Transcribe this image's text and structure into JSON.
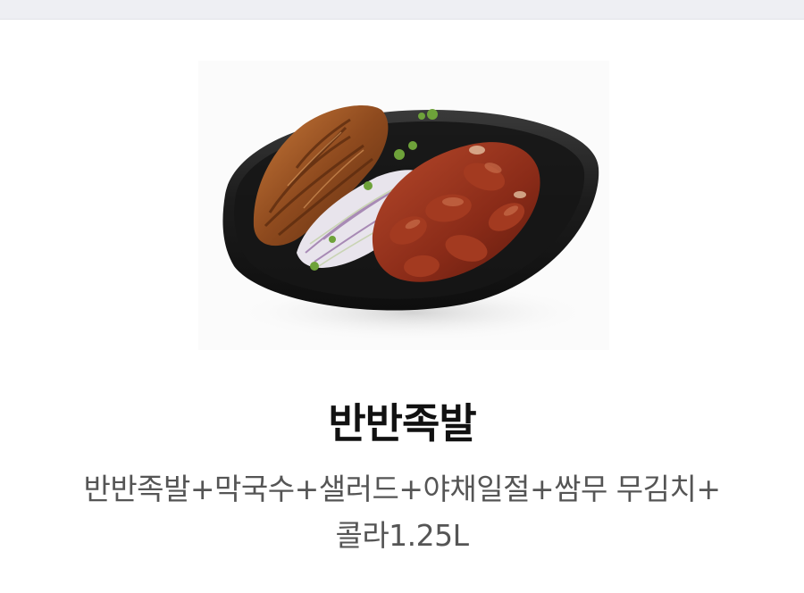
{
  "menu": {
    "image_alt": "반반족발",
    "title": "반반족발",
    "description_line1": "반반족발+막국수+샐러드+야채일절+쌈무 무김치+",
    "description_line2": "콜라1.25L"
  },
  "colors": {
    "top_bar": "#eeeff3",
    "title": "#111111",
    "description": "#555555",
    "plate": "#1b1b1b"
  }
}
